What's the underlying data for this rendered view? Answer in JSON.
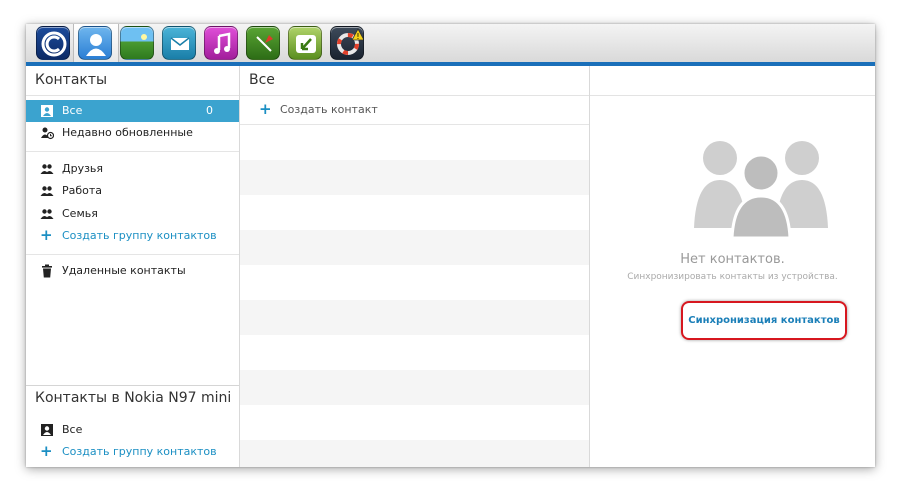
{
  "colors": {
    "accent": "#1a6fb9",
    "selected": "#3ba3cf",
    "link": "#1b8fc3",
    "highlight": "#d7171f"
  },
  "toolbar": {
    "icons": [
      "app-logo-icon",
      "contacts-icon",
      "photos-icon",
      "mail-icon",
      "music-icon",
      "maps-icon",
      "backup-icon",
      "support-icon"
    ]
  },
  "left": {
    "title": "Контакты",
    "all_label": "Все",
    "all_count": "0",
    "recent_label": "Недавно обновленные",
    "groups": [
      "Друзья",
      "Работа",
      "Семья"
    ],
    "create_group": "Создать группу контактов",
    "deleted": "Удаленные контакты",
    "device_title": "Контакты в Nokia N97 mini",
    "device_all": "Все",
    "device_create_group": "Создать группу контактов"
  },
  "middle": {
    "title": "Все",
    "create_contact": "Создать контакт"
  },
  "right": {
    "empty_title": "Нет контактов.",
    "empty_sub": "Синхронизировать контакты из устройства.",
    "sync_button": "Синхронизация контактов"
  }
}
